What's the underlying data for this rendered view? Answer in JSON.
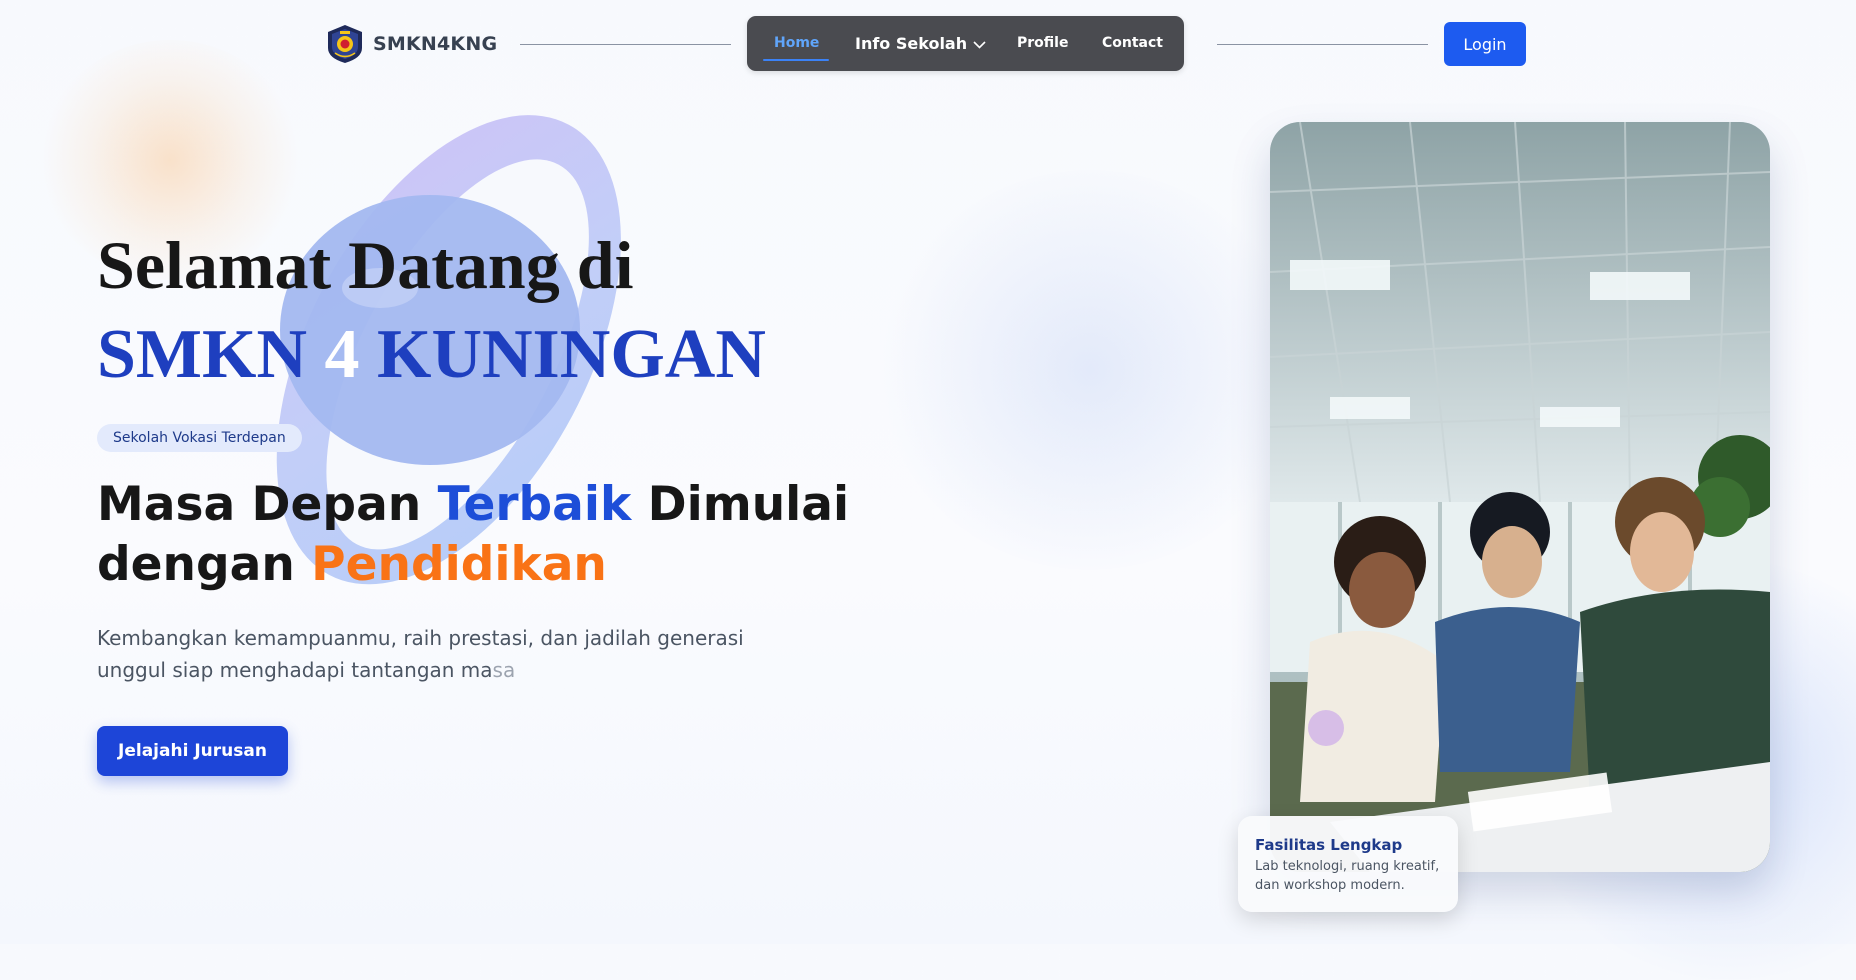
{
  "nav": {
    "brand": "SMKN4KNG",
    "items": [
      {
        "label": "Home",
        "active": true
      },
      {
        "label": "Info Sekolah",
        "has_dropdown": true
      },
      {
        "label": "Profile"
      },
      {
        "label": "Contact"
      }
    ],
    "login_label": "Login"
  },
  "hero": {
    "title_line1": "Selamat Datang di",
    "title_line2_part1": "SMKN ",
    "title_line2_num": "4",
    "title_line2_part2": " KUNINGAN",
    "badge": "Sekolah Vokasi Terdepan",
    "headline": {
      "part1": "Masa Depan ",
      "blue": "Terbaik",
      "part2": " Dimulai",
      "part3": "dengan ",
      "orange": "Pendidikan"
    },
    "description": "Kembangkan kemampuanmu, raih prestasi, dan jadilah generasi unggul siap menghadapi tantangan ma",
    "description_fade": "sa",
    "cta_label": "Jelajahi Jurusan"
  },
  "facility": {
    "title": "Fasilitas Lengkap",
    "description": "Lab teknologi, ruang kreatif, dan workshop modern."
  },
  "colors": {
    "accent_blue": "#1d4ed8",
    "accent_orange": "#f97316",
    "nav_bg": "#4a4b50",
    "login_bg": "#1d5bf0"
  }
}
